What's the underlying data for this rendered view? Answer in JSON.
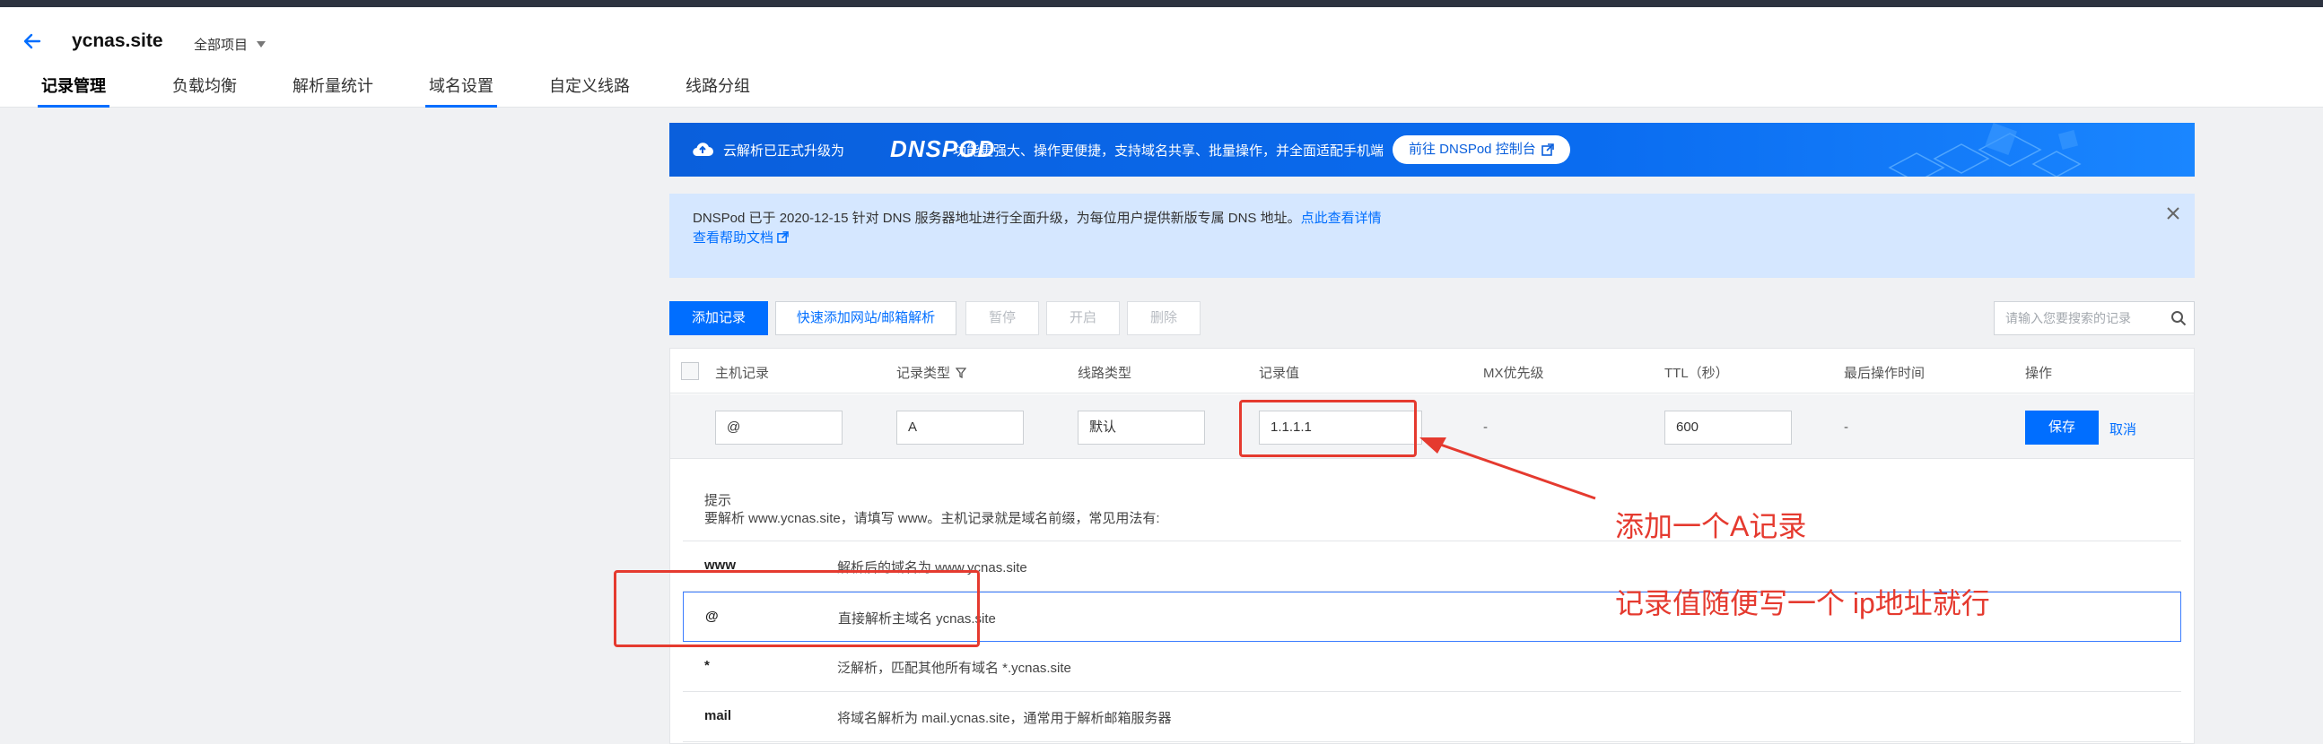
{
  "header": {
    "site": "ycnas.site",
    "project": "全部项目"
  },
  "tabs": [
    {
      "label": "记录管理"
    },
    {
      "label": "负载均衡"
    },
    {
      "label": "解析量统计"
    },
    {
      "label": "域名设置"
    },
    {
      "label": "自定义线路"
    },
    {
      "label": "线路分组"
    }
  ],
  "banner": {
    "text1": "云解析已正式升级为",
    "logo": "DNSPOD",
    "text2": "功能更强大、操作更便捷，支持域名共享、批量操作，并全面适配手机端",
    "button": "前往 DNSPod 控制台"
  },
  "notice": {
    "text": "DNSPod 已于 2020-12-15 针对 DNS 服务器地址进行全面升级，为每位用户提供新版专属 DNS 地址。",
    "link": "点此查看详情",
    "help": "查看帮助文档"
  },
  "toolbar": {
    "add": "添加记录",
    "quick_add": "快速添加网站/邮箱解析",
    "pause": "暂停",
    "enable": "开启",
    "delete": "删除",
    "search_placeholder": "请输入您要搜索的记录"
  },
  "table": {
    "columns": [
      "主机记录",
      "记录类型",
      "线路类型",
      "记录值",
      "MX优先级",
      "TTL（秒）",
      "最后操作时间",
      "操作"
    ],
    "edit_row": {
      "host": "@",
      "type": "A",
      "line": "默认",
      "value": "1.1.1.1",
      "mx": "-",
      "ttl": "600",
      "last_op": "-",
      "save": "保存",
      "cancel": "取消"
    }
  },
  "tips": {
    "title": "提示",
    "desc": "要解析 www.ycnas.site，请填写 www。主机记录就是域名前缀，常见用法有:",
    "rows": [
      {
        "key": "www",
        "value": "解析后的域名为 www.ycnas.site"
      },
      {
        "key": "@",
        "value": "直接解析主域名 ycnas.site"
      },
      {
        "key": "*",
        "value": "泛解析，匹配其他所有域名 *.ycnas.site"
      },
      {
        "key": "mail",
        "value": "将域名解析为 mail.ycnas.site，通常用于解析邮箱服务器"
      }
    ]
  },
  "annotations": {
    "line1": "添加一个A记录",
    "line2": "记录值随便写一个 ip地址就行",
    "color": "#e53a2f"
  },
  "colors": {
    "accent": "#006eff",
    "banner": "#0a5fdc",
    "notice_bg": "#d5e7ff"
  }
}
